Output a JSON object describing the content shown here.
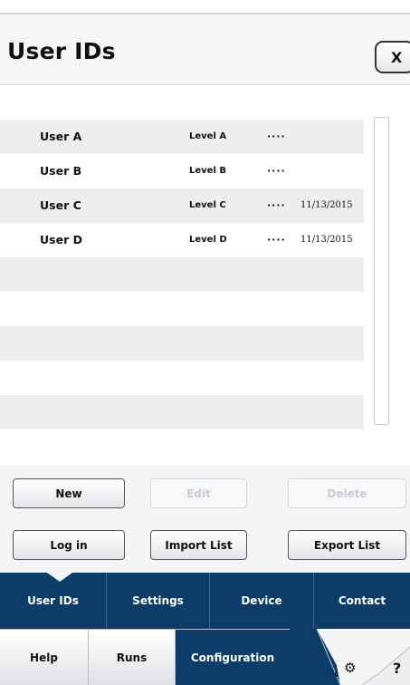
{
  "header": {
    "title": "User IDs",
    "close_label": "X"
  },
  "users": [
    {
      "name": "User A",
      "level": "Level A",
      "password": "····",
      "date": ""
    },
    {
      "name": "User B",
      "level": "Level B",
      "password": "····",
      "date": ""
    },
    {
      "name": "User C",
      "level": "Level C",
      "password": "····",
      "date": "11/13/2015"
    },
    {
      "name": "User D",
      "level": "Level D",
      "password": "····",
      "date": "11/13/2015"
    }
  ],
  "actions": {
    "new": "New",
    "edit": "Edit",
    "delete": "Delete",
    "login": "Log in",
    "import": "Import List",
    "export": "Export List"
  },
  "nav_primary": [
    {
      "label": "User IDs"
    },
    {
      "label": "Settings"
    },
    {
      "label": "Device"
    },
    {
      "label": "Contact"
    }
  ],
  "nav_secondary": [
    {
      "label": "Help"
    },
    {
      "label": "Runs"
    },
    {
      "label": "Configuration"
    }
  ],
  "nav_tools": {
    "back_icon": "chevron-left-icon",
    "gears_icon": "gears-icon",
    "help_label": "?"
  },
  "colors": {
    "nav_blue": "#0c3d69",
    "row_alt": "#edeef0"
  }
}
